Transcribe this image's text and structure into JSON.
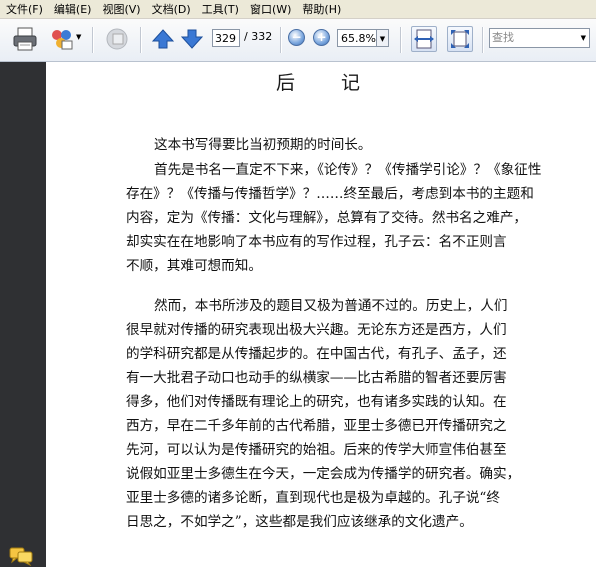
{
  "menu": {
    "items": [
      "文件(F)",
      "编辑(E)",
      "视图(V)",
      "文档(D)",
      "工具(T)",
      "窗口(W)",
      "帮助(H)"
    ]
  },
  "toolbar": {
    "current_page": "329",
    "total_pages": "/ 332",
    "zoom": "65.8%",
    "search_placeholder": "查找"
  },
  "document": {
    "title": "后记",
    "paragraphs": [
      {
        "lines": [
          "这本书写得要比当初预期的时间长。"
        ]
      },
      {
        "lines": [
          "首先是书名一直定不下来，《论传》？《传播学引论》？《象征性",
          "存在》？《传播与传播哲学》？……终至最后，考虑到本书的主题和",
          "内容，定为《传播：文化与理解》，总算有了交待。然书名之难产，",
          "却实实在在地影响了本书应有的写作过程，孔子云：名不正则言",
          "不顺，其难可想而知。"
        ]
      },
      {
        "lines": [
          "然而，本书所涉及的题目又极为普通不过的。历史上，人们",
          "很早就对传播的研究表现出极大兴趣。无论东方还是西方，人们",
          "的学科研究都是从传播起步的。在中国古代，有孔子、孟子，还",
          "有一大批君子动口也动手的纵横家——比古希腊的智者还要厉害",
          "得多，他们对传播既有理论上的研究，也有诸多实践的认知。在",
          "西方，早在二千多年前的古代希腊，亚里士多德已开传播研究之",
          "先河，可以认为是传播研究的始祖。后来的传学大师宣伟伯甚至",
          "说假如亚里士多德生在今天，一定会成为传播学的研究者。确实，",
          "亚里士多德的诸多论断，直到现代也是极为卓越的。孔子说“终",
          "日思之，不如学之”，这些都是我们应该继承的文化遗产。"
        ]
      }
    ]
  }
}
